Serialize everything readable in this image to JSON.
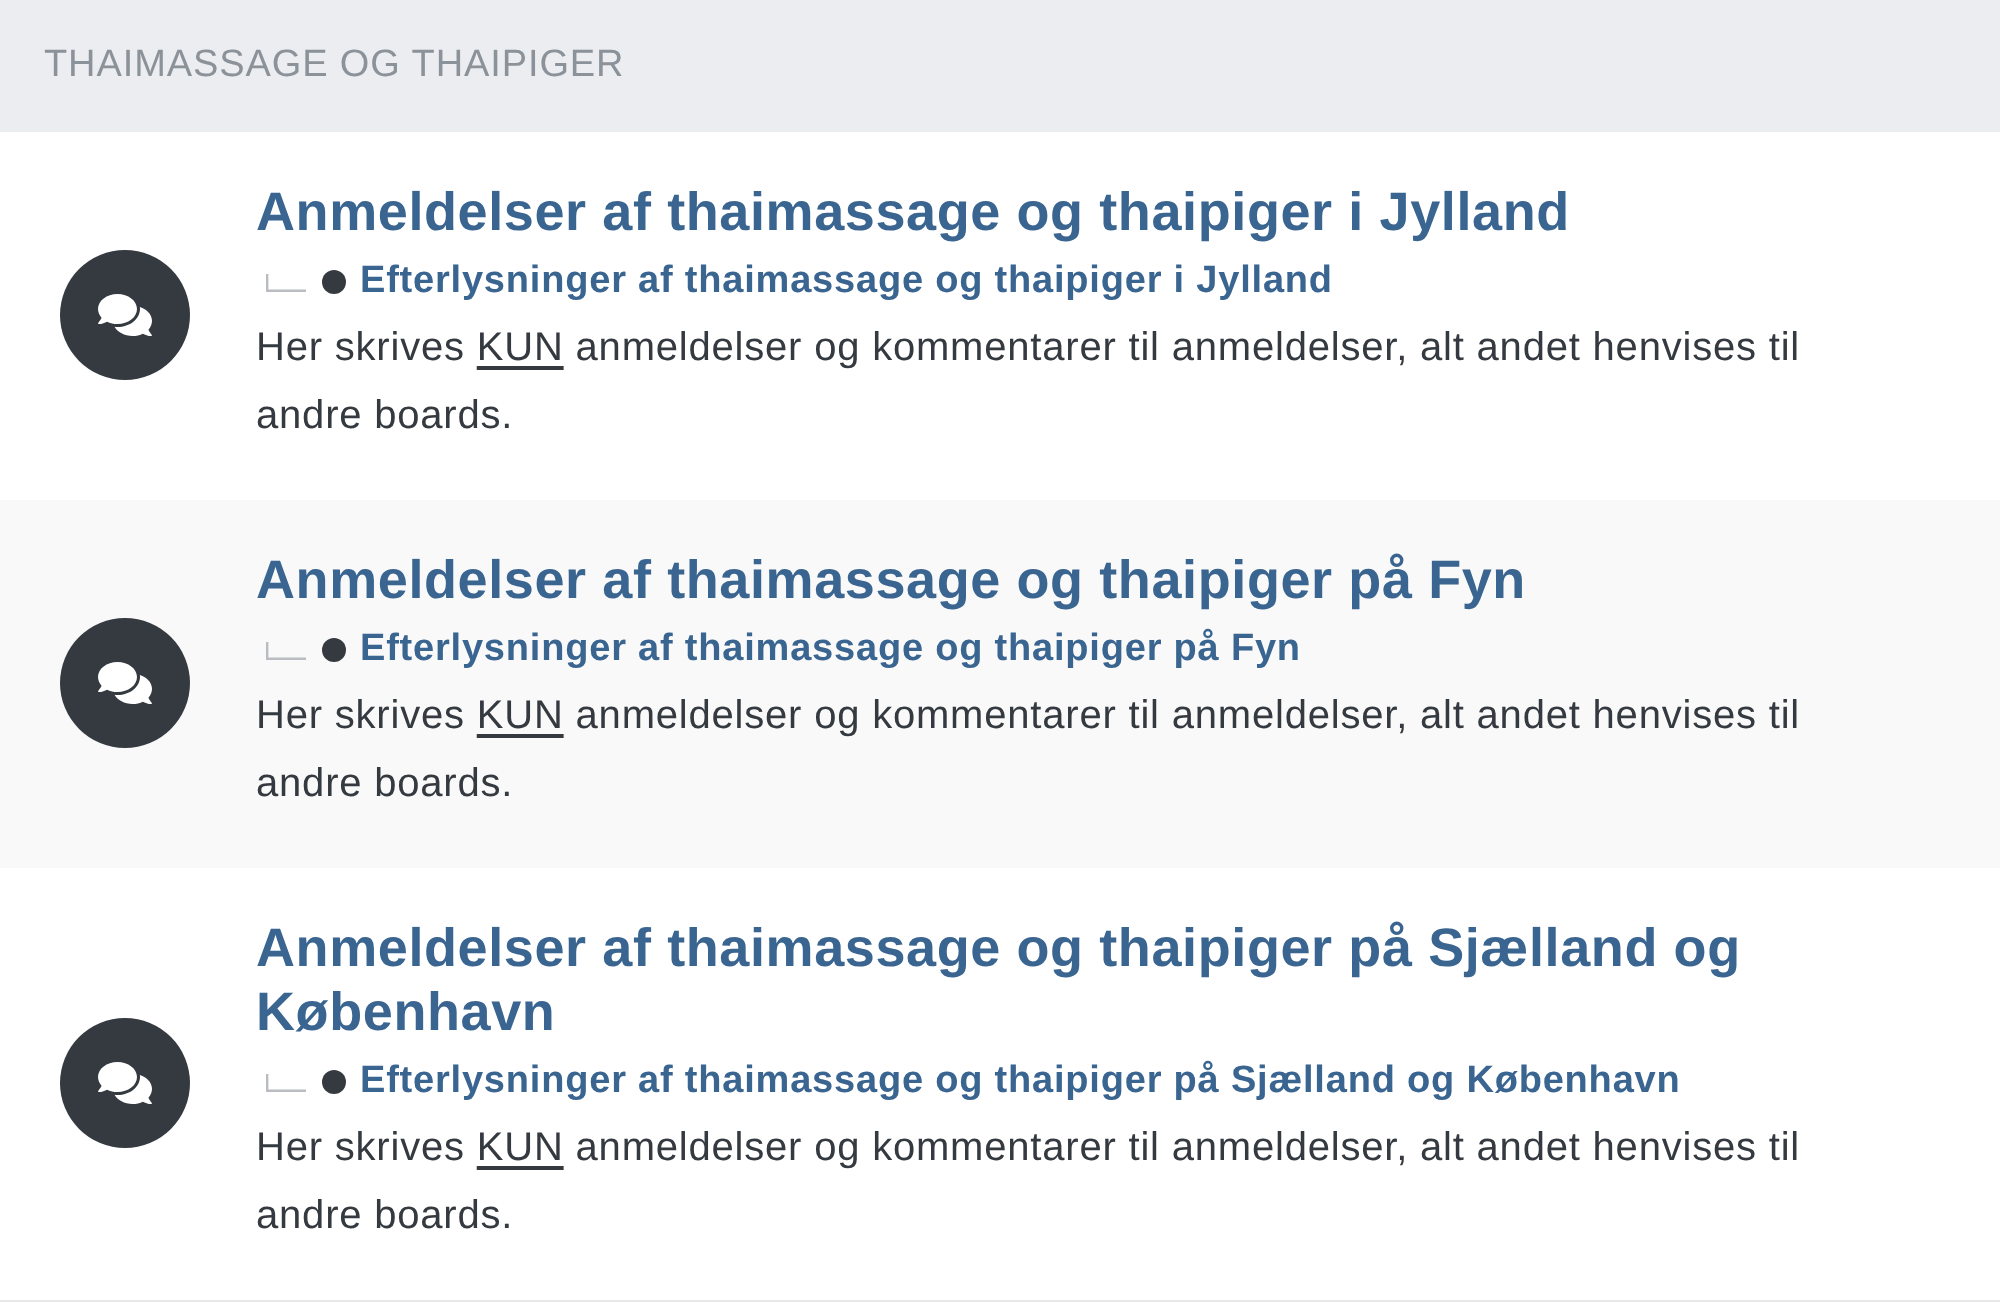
{
  "section": {
    "title": "THAIMASSAGE OG THAIPIGER"
  },
  "forums": [
    {
      "title": "Anmeldelser af thaimassage og thaipiger i Jylland",
      "subforums": [
        {
          "label": "Efterlysninger af thaimassage og thaipiger i Jylland"
        }
      ],
      "description": [
        {
          "text": "Her skrives ",
          "underline": false
        },
        {
          "text": "KUN",
          "underline": true
        },
        {
          "text": " anmeldelser og kommentarer til anmeldelser, alt andet henvises til andre boards.",
          "underline": false
        }
      ]
    },
    {
      "title": "Anmeldelser af thaimassage og thaipiger på Fyn",
      "subforums": [
        {
          "label": "Efterlysninger af thaimassage og thaipiger på Fyn"
        }
      ],
      "description": [
        {
          "text": "Her skrives ",
          "underline": false
        },
        {
          "text": "KUN",
          "underline": true
        },
        {
          "text": " anmeldelser og kommentarer til anmeldelser, alt andet henvises til andre boards.",
          "underline": false
        }
      ]
    },
    {
      "title": "Anmeldelser af thaimassage og thaipiger på Sjælland og København",
      "subforums": [
        {
          "label": "Efterlysninger af thaimassage og thaipiger på Sjælland og København"
        }
      ],
      "description": [
        {
          "text": "Her skrives ",
          "underline": false
        },
        {
          "text": "KUN",
          "underline": true
        },
        {
          "text": " anmeldelser og kommentarer til anmeldelser, alt andet henvises til andre boards.",
          "underline": false
        }
      ]
    }
  ]
}
